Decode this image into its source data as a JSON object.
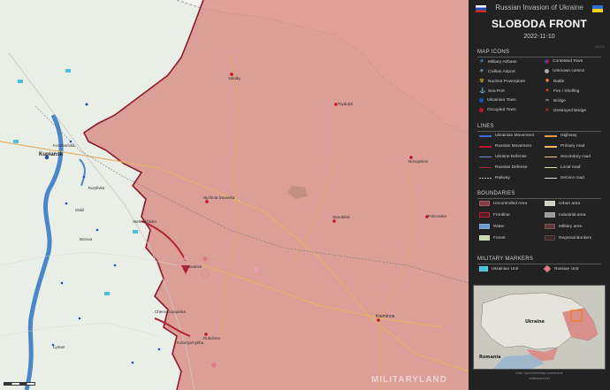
{
  "panel": {
    "header": "Russian Invasion of Ukraine",
    "title": "SLOBODA FRONT",
    "date": "2022-11-10",
    "version": "v1.0.1"
  },
  "sections": {
    "icons": "MAP ICONS",
    "lines": "LINES",
    "boundaries": "BOUNDARIES",
    "markers": "MILITARY MARKERS"
  },
  "icons_left": [
    "Military Airbase",
    "Civilian Airport",
    "Nuclear Powerplant",
    "Sea Port",
    "Ukrainian Town",
    "Occupied Town"
  ],
  "icons_right": [
    "Contested Town",
    "Unknown control",
    "Battle",
    "Fire / Shelling",
    "Bridge",
    "Destroyed Bridge"
  ],
  "lines_left": [
    "Ukrainian Movement",
    "Russian Movement",
    "Ukraine Defense",
    "Russian Defense",
    "Railway"
  ],
  "lines_right": [
    "Highway",
    "Primary road",
    "Secondary road",
    "Local road",
    "Service road"
  ],
  "boundaries_left": [
    "Uncontrolled Area",
    "Frontline",
    "Water",
    "Forest"
  ],
  "boundaries_right": [
    "Urban area",
    "Industrial area",
    "Military area",
    "Regional Borders"
  ],
  "markers": [
    "Ukrainian Unit",
    "Russian Unit"
  ],
  "inset": {
    "ukraine": "Ukraine",
    "romania": "Romania"
  },
  "credit": [
    "Data: OpenStreetMap contributors",
    "militaryland.net"
  ],
  "watermark": "MILITARYLAND",
  "places": {
    "kupiansk": "Kupiansk",
    "valuiky": "Valuiky",
    "tsydulyk": "Tsydulyk",
    "nyzhnia_duvanka": "Nyzhnia Duvanka",
    "svatove": "Svatove",
    "kreminna": "Kreminna",
    "novopskov": "Novopskov",
    "starobilsk": "Starobilsk",
    "pokrovske": "Pokrovske",
    "kovsharivka": "Kovsharivka",
    "borova": "Borova",
    "lyman": "Lyman",
    "rubizhne": "Rubizhne",
    "kolomyichykha": "Kolomyichykha",
    "oskil": "Oskil",
    "kurylivka": "Kurylivka",
    "stelmakhivka": "Stelmakhivka",
    "chervonopopivka": "Chervonopopivka"
  },
  "colors": {
    "occupied": "#d9908a",
    "frontline": "#8b1a2b",
    "water": "#4a87c8",
    "panel_bg": "#222222",
    "russia_unit": "#e07a8a",
    "ukraine_unit": "#4cc0e0"
  }
}
